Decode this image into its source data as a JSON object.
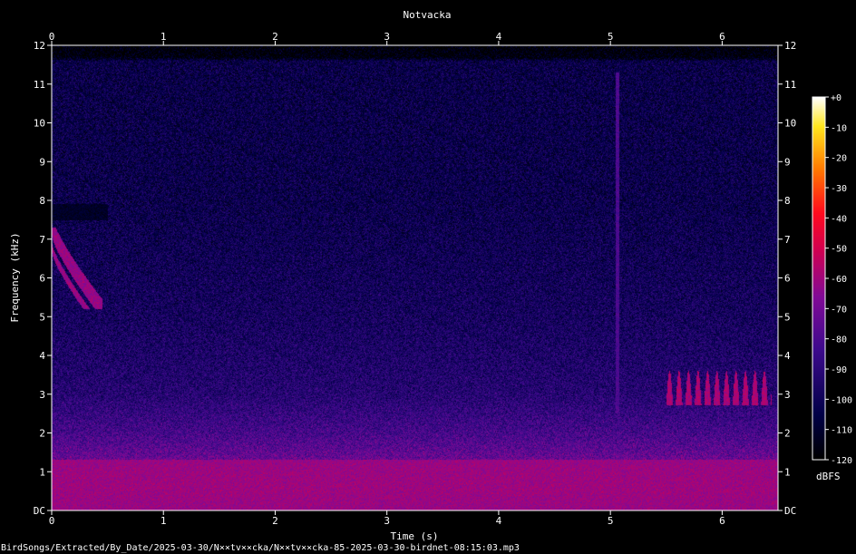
{
  "chart_data": {
    "type": "heatmap",
    "title": "Notvacka",
    "xlabel": "Time (s)",
    "ylabel": "Frequency (kHz)",
    "xlim": [
      0,
      6.5
    ],
    "ylim": [
      0,
      12
    ],
    "x_ticks": [
      "0",
      "1",
      "2",
      "3",
      "4",
      "5",
      "6"
    ],
    "y_ticks": [
      "DC",
      "1",
      "2",
      "3",
      "4",
      "5",
      "6",
      "7",
      "8",
      "9",
      "10",
      "11",
      "12"
    ],
    "colorbar": {
      "label": "dBFS",
      "ticks": [
        "+0",
        "-10",
        "-20",
        "-30",
        "-40",
        "-50",
        "-60",
        "-70",
        "-80",
        "-90",
        "-100",
        "-110",
        "-120"
      ],
      "range": [
        -120,
        0
      ]
    },
    "background_level_profile": [
      {
        "freq": 0.0,
        "db": -72
      },
      {
        "freq": 0.5,
        "db": -66
      },
      {
        "freq": 1.0,
        "db": -68
      },
      {
        "freq": 1.5,
        "db": -75
      },
      {
        "freq": 2.0,
        "db": -82
      },
      {
        "freq": 3.0,
        "db": -92
      },
      {
        "freq": 5.0,
        "db": -98
      },
      {
        "freq": 8.0,
        "db": -103
      },
      {
        "freq": 11.6,
        "db": -104
      },
      {
        "freq": 11.7,
        "db": -118
      },
      {
        "freq": 12.0,
        "db": -120
      }
    ],
    "events": [
      {
        "t_start": 0.0,
        "t_end": 0.45,
        "f_low": 5.2,
        "f_high": 7.3,
        "db": -62,
        "shape": "downsweep-arcs"
      },
      {
        "t_start": 0.0,
        "t_end": 0.5,
        "f_low": 7.5,
        "f_high": 7.9,
        "db": -112,
        "shape": "dark-band"
      },
      {
        "t_start": 5.05,
        "t_end": 5.08,
        "f_low": 2.5,
        "f_high": 11.3,
        "db": -80,
        "shape": "vertical-line"
      },
      {
        "t_start": 5.5,
        "t_end": 6.45,
        "f_low": 2.2,
        "f_high": 3.6,
        "db": -58,
        "shape": "repeated-arcs"
      },
      {
        "t_start": 0.0,
        "t_end": 6.5,
        "f_low": 0.0,
        "f_high": 1.3,
        "db": -62,
        "shape": "band"
      }
    ]
  },
  "footer": {
    "path": "BirdSongs/Extracted/By_Date/2025-03-30/N××tv××cka/N××tv××cka-85-2025-03-30-birdnet-08:15:03.mp3"
  }
}
